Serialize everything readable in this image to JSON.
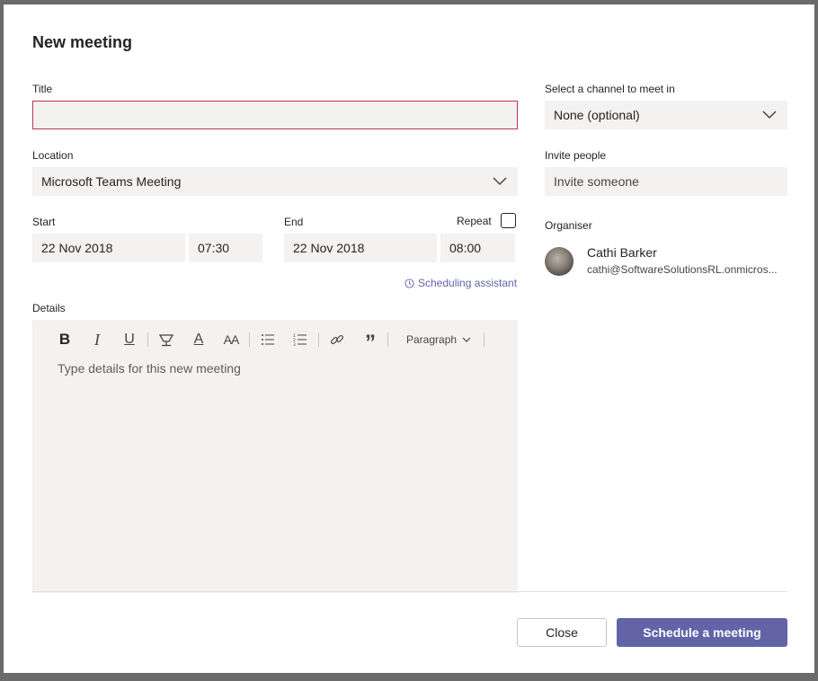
{
  "dialog": {
    "title": "New meeting"
  },
  "form": {
    "title_label": "Title",
    "title_value": "",
    "location_label": "Location",
    "location_value": "Microsoft Teams Meeting",
    "start_label": "Start",
    "start_date": "22 Nov 2018",
    "start_time": "07:30",
    "end_label": "End",
    "end_date": "22 Nov 2018",
    "end_time": "08:00",
    "repeat_label": "Repeat",
    "repeat_checked": false,
    "scheduling_assistant": "Scheduling assistant",
    "details_label": "Details",
    "details_placeholder": "Type details for this new meeting"
  },
  "toolbar": {
    "bold_glyph": "B",
    "italic_glyph": "I",
    "underline_glyph": "U",
    "font_color_glyph": "A",
    "font_size_glyph": "AA",
    "quote_glyph": "”",
    "paragraph_label": "Paragraph"
  },
  "sidebar": {
    "channel_label": "Select a channel to meet in",
    "channel_value": "None (optional)",
    "invite_label": "Invite people",
    "invite_placeholder": "Invite someone",
    "organiser_label": "Organiser",
    "organiser_name": "Cathi Barker",
    "organiser_email": "cathi@SoftwareSolutionsRL.onmicros..."
  },
  "footer": {
    "close_label": "Close",
    "schedule_label": "Schedule a meeting"
  },
  "colors": {
    "accent": "#6264a7",
    "error_border": "#c4314b",
    "field_bg": "#f3f2f1"
  }
}
